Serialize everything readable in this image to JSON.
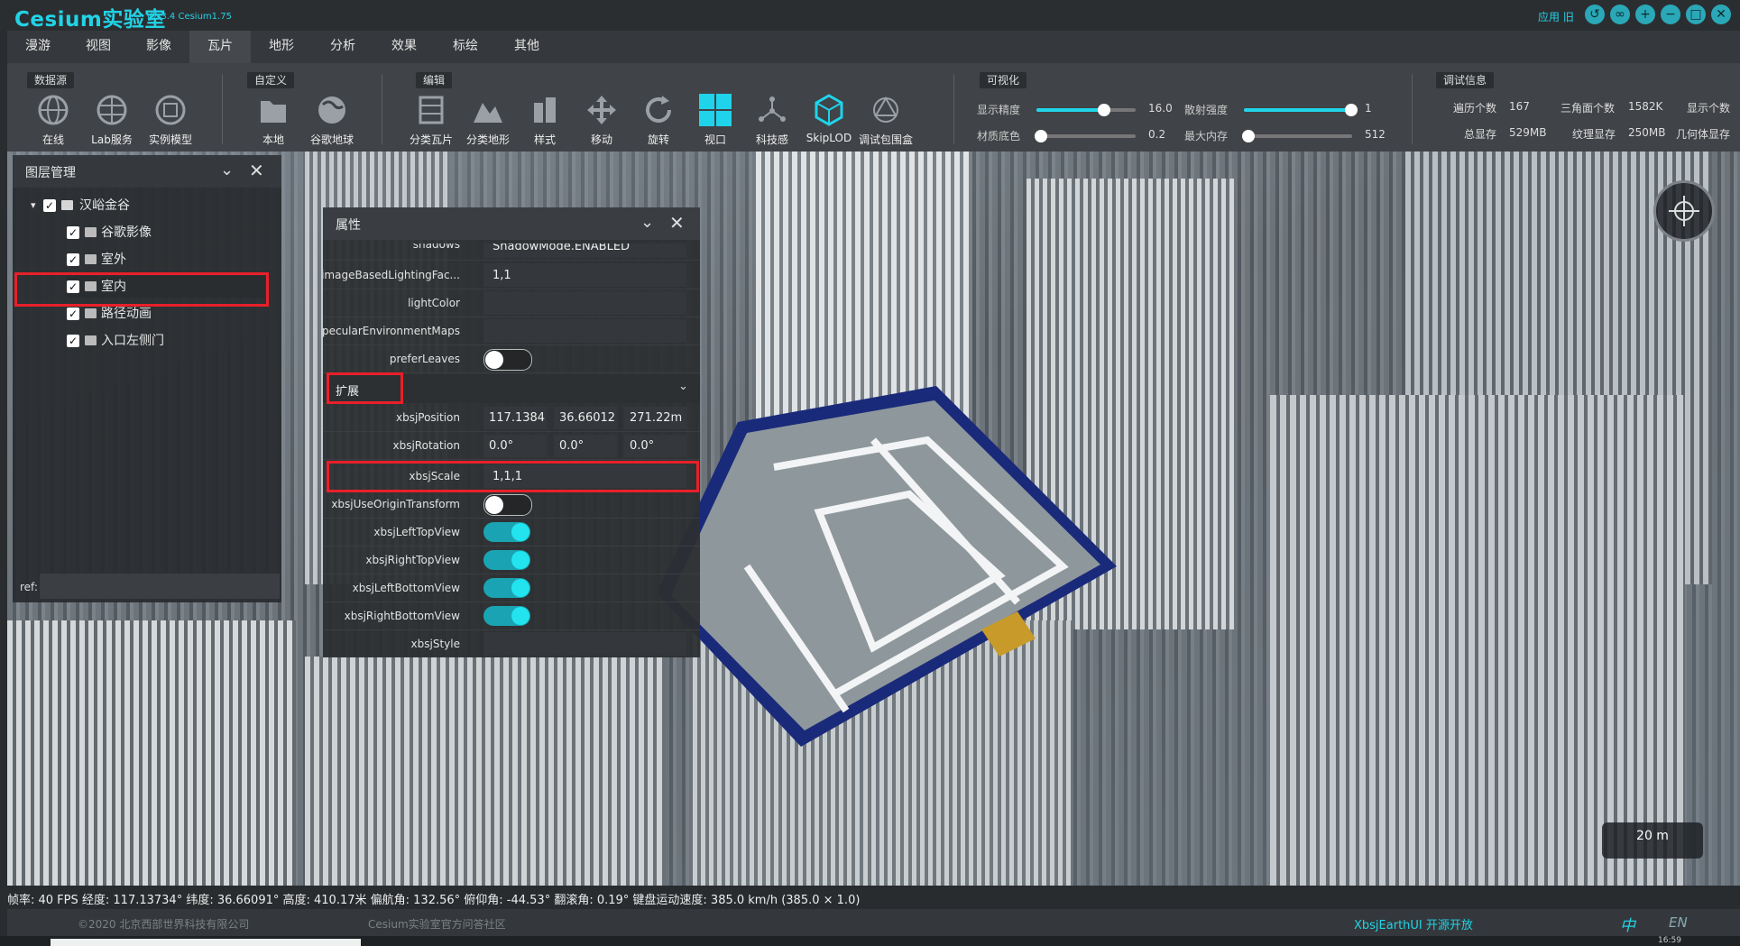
{
  "header": {
    "title": "Cesium实验室",
    "version": "V2.3.4  Cesium1.75",
    "login": "应用 旧",
    "window_buttons": [
      "refresh-icon",
      "link-icon",
      "plus-icon",
      "minimize-icon",
      "maximize-icon",
      "close-icon"
    ]
  },
  "menu": [
    "漫游",
    "视图",
    "影像",
    "瓦片",
    "地形",
    "分析",
    "效果",
    "标绘",
    "其他"
  ],
  "menu_active": "瓦片",
  "toolbar": {
    "groups": {
      "datasource": "数据源",
      "custom": "自定义",
      "edit": "编辑",
      "visual": "可视化",
      "debug": "调试信息"
    },
    "datasource_tools": [
      "在线",
      "Lab服务",
      "实例模型"
    ],
    "custom_tools": [
      "本地",
      "谷歌地球"
    ],
    "edit_tools": [
      "分类瓦片",
      "分类地形",
      "样式",
      "移动",
      "旋转",
      "视口",
      "科技感",
      "SkipLOD",
      "调试包围盒"
    ],
    "sliders": [
      {
        "label": "显示精度",
        "value": "16.0",
        "fraction": 0.68
      },
      {
        "label": "散射强度",
        "value": "1",
        "fraction": 1.0
      },
      {
        "label": "材质底色",
        "value": "0.2",
        "fraction": 0.0
      },
      {
        "label": "最大内存",
        "value": "512",
        "fraction": 0.0
      }
    ],
    "stats": [
      {
        "label": "遍历个数",
        "value": "167"
      },
      {
        "label": "三角面个数",
        "value": "1582K"
      },
      {
        "label": "显示个数",
        "value": ""
      },
      {
        "label": "总显存",
        "value": "529MB"
      },
      {
        "label": "纹理显存",
        "value": "250MB"
      },
      {
        "label": "几何体显存",
        "value": ""
      }
    ]
  },
  "layer_panel": {
    "title": "图层管理",
    "root": "汉峪金谷",
    "items": [
      "谷歌影像",
      "室外",
      "室内",
      "路径动画",
      "入口左侧门"
    ],
    "ref_label": "ref:"
  },
  "property_panel": {
    "title": "属性",
    "rows": [
      {
        "label": "shadows",
        "value": "ShadowMode.ENABLED"
      },
      {
        "label": "imageBasedLightingFac...",
        "value": "1,1"
      },
      {
        "label": "lightColor",
        "value": ""
      },
      {
        "label": "specularEnvironmentMaps",
        "value": ""
      }
    ],
    "prefer_leaves_label": "preferLeaves",
    "section_ext": "扩展",
    "position_label": "xbsjPosition",
    "position": [
      "117.1384",
      "36.66012",
      "271.22m"
    ],
    "rotation_label": "xbsjRotation",
    "rotation": [
      "0.0°",
      "0.0°",
      "0.0°"
    ],
    "scale_label": "xbsjScale",
    "scale": "1,1,1",
    "toggles": [
      {
        "label": "xbsjUseOriginTransform",
        "on": false
      },
      {
        "label": "xbsjLeftTopView",
        "on": true
      },
      {
        "label": "xbsjRightTopView",
        "on": true
      },
      {
        "label": "xbsjLeftBottomView",
        "on": true
      },
      {
        "label": "xbsjRightBottomView",
        "on": true
      }
    ],
    "style_label": "xbsjStyle"
  },
  "map": {
    "scale": "20 m"
  },
  "status": {
    "line": "帧率: 40 FPS 经度: 117.13734° 纬度: 36.66091° 高度: 410.17米 偏航角: 132.56° 俯仰角: -44.53° 翻滚角: 0.19° 键盘运动速度: 385.0 km/h (385.0 × 1.0)"
  },
  "footer": {
    "copyright": "©2020 北京西部世界科技有限公司",
    "community": "Cesium实验室官方问答社区",
    "opensource": "XbsjEarthUI 开源开放",
    "lang_zh": "中",
    "lang_en": "EN",
    "clock": "16:59"
  },
  "colors": {
    "accent": "#22d3e6",
    "highlight": "#e8202a",
    "toggle_on": "#22e3ee"
  }
}
